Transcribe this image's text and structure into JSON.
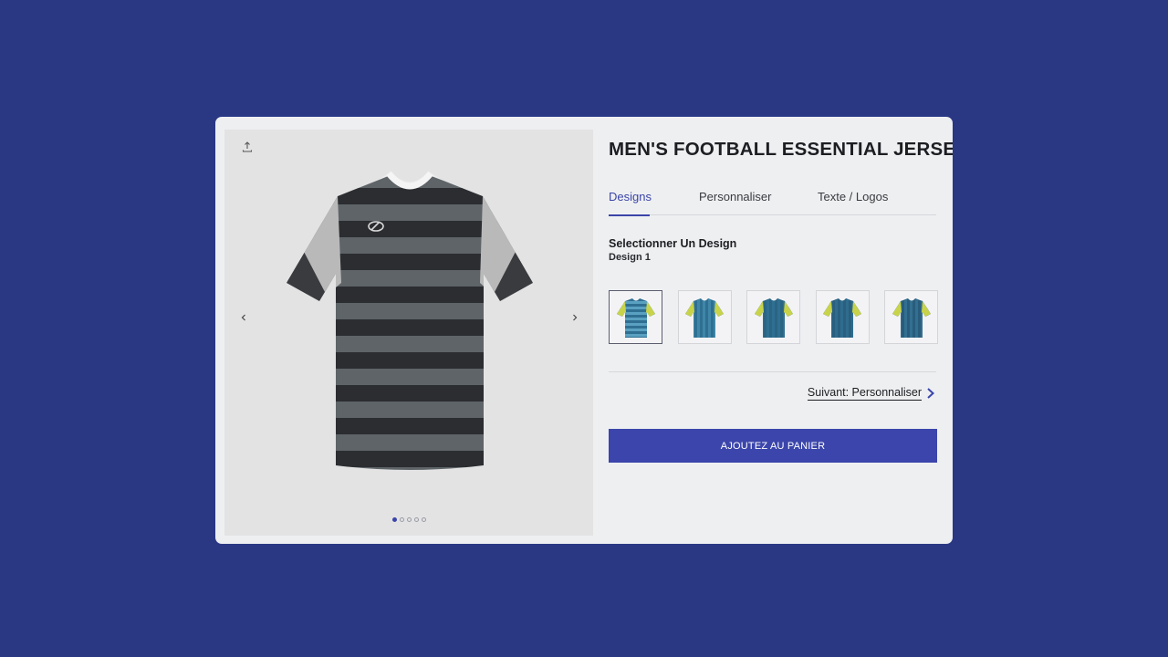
{
  "product": {
    "title": "MEN'S FOOTBALL ESSENTIAL JERSEY"
  },
  "gallery": {
    "share_icon": "share-upload-icon",
    "prev_icon": "chevron-left-icon",
    "next_icon": "chevron-right-icon",
    "image_count": 5,
    "active_index": 0
  },
  "tabs": [
    {
      "label": "Designs",
      "active": true
    },
    {
      "label": "Personnaliser",
      "active": false
    },
    {
      "label": "Texte / Logos",
      "active": false
    }
  ],
  "design": {
    "heading": "Selectionner Un Design",
    "selected": "Design 1",
    "option_count": 5,
    "selected_index": 0
  },
  "actions": {
    "next_label": "Suivant: Personnaliser",
    "add_to_cart_label": "AJOUTEZ AU PANIER"
  },
  "colors": {
    "background": "#2a3884",
    "accent": "#3b45ab",
    "jersey_dark": "#2b2d31",
    "jersey_light": "#5e6468",
    "thumb_blue": "#2f6f92",
    "thumb_yellow": "#c9d34a"
  }
}
